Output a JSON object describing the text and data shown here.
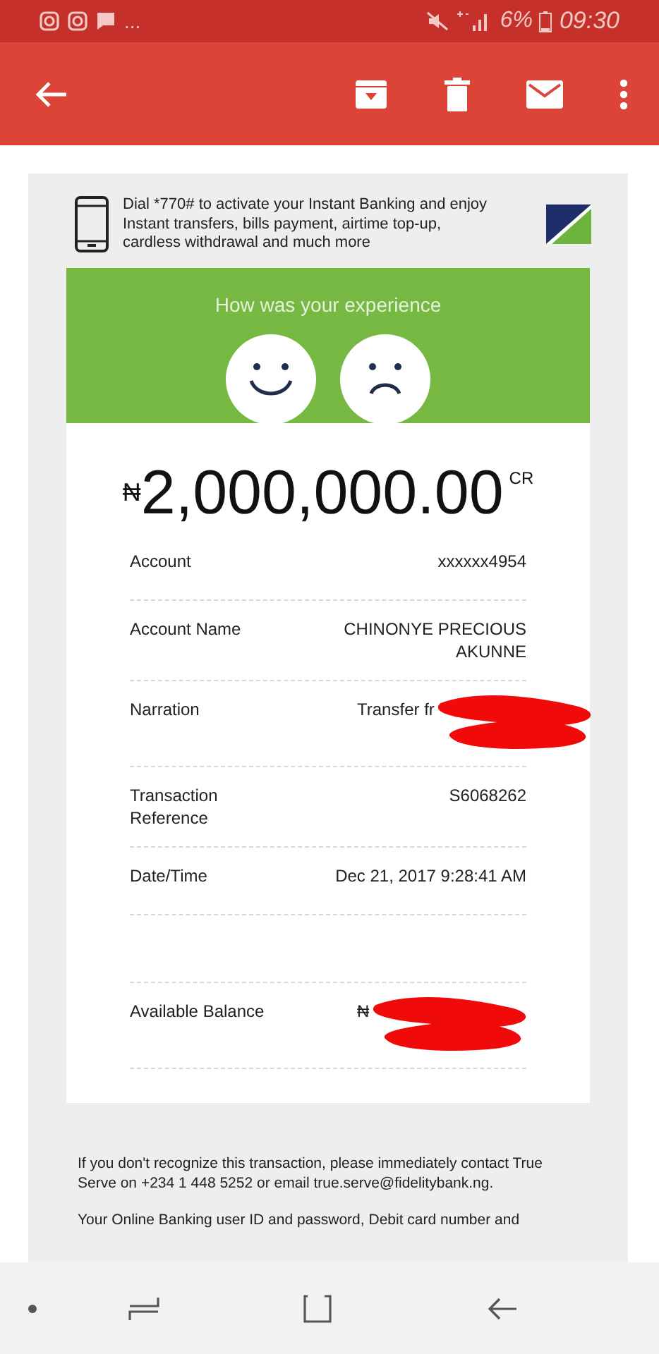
{
  "status_bar": {
    "overflow": "...",
    "battery": "6%",
    "time": "09:30"
  },
  "receipt": {
    "promo": "Dial *770# to activate your Instant Banking and enjoy Instant transfers, bills payment, airtime top-up, cardless withdrawal and much more",
    "feedback_title": "How was your experience",
    "currency": "₦",
    "amount": "2,000,000.00",
    "amount_suffix": "CR",
    "rows": [
      {
        "kind": "field",
        "label": "Account",
        "value": "xxxxxx4954",
        "redacted": false
      },
      {
        "kind": "field",
        "label": "Account Name",
        "value": "CHINONYE PRECIOUS AKUNNE",
        "redacted": false
      },
      {
        "kind": "field",
        "label": "Narration",
        "value": "Transfer fr",
        "redacted": true
      },
      {
        "kind": "field",
        "label": "Transaction Reference",
        "value": "S6068262",
        "redacted": false
      },
      {
        "kind": "field",
        "label": "Date/Time",
        "value": "Dec 21, 2017 9:28:41 AM",
        "redacted": false
      },
      {
        "kind": "spacer"
      },
      {
        "kind": "field",
        "label": "Available Balance",
        "value": "₦",
        "redacted": true
      }
    ]
  },
  "footer": [
    "If you don't recognize this transaction, please immediately contact True Serve on +234 1 448 5252 or email true.serve@fidelitybank.ng.",
    "Your Online Banking user ID and password, Debit card number and"
  ]
}
